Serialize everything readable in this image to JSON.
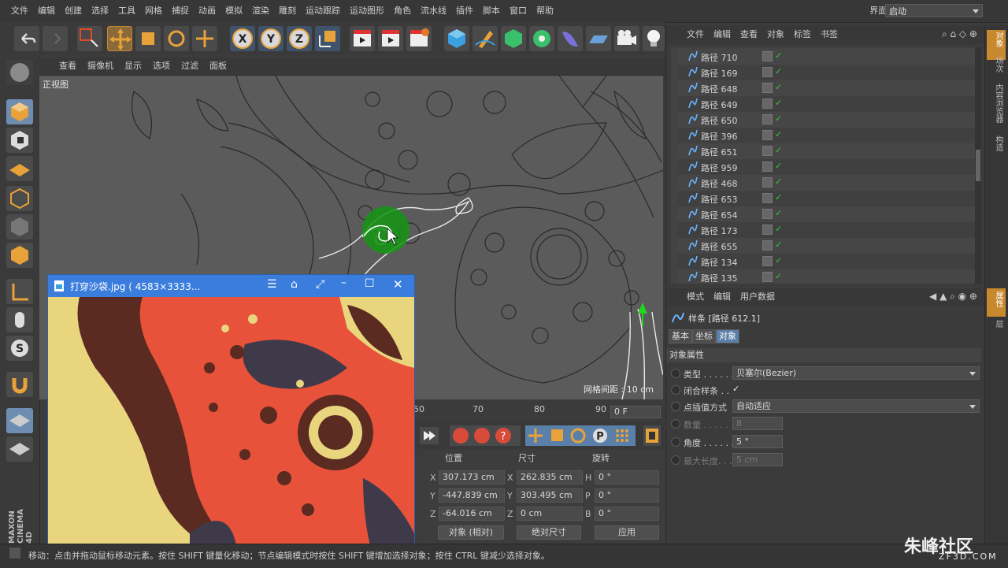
{
  "menubar": {
    "items": [
      "文件",
      "编辑",
      "创建",
      "选择",
      "工具",
      "网格",
      "捕捉",
      "动画",
      "模拟",
      "渲染",
      "雕刻",
      "运动跟踪",
      "运动图形",
      "角色",
      "流水线",
      "插件",
      "脚本",
      "窗口",
      "帮助"
    ],
    "layout_label": "界面:",
    "layout_value": "启动"
  },
  "viewport": {
    "menu": [
      "查看",
      "摄像机",
      "显示",
      "选项",
      "过滤",
      "面板"
    ],
    "title": "正视图",
    "grid_label": "网格间距 : 10 cm"
  },
  "timeline": {
    "ticks": [
      "50",
      "70",
      "80",
      "90"
    ],
    "frame": "0 F"
  },
  "coords": {
    "headers": [
      "位置",
      "尺寸",
      "旋转"
    ],
    "rows": [
      {
        "a1": "X",
        "v1": "307.173 cm",
        "a2": "X",
        "v2": "262.835 cm",
        "a3": "H",
        "v3": "0 °"
      },
      {
        "a1": "Y",
        "v1": "-447.839 cm",
        "a2": "Y",
        "v2": "303.495 cm",
        "a3": "P",
        "v3": "0 °"
      },
      {
        "a1": "Z",
        "v1": "-64.016 cm",
        "a2": "Z",
        "v2": "0 cm",
        "a3": "B",
        "v3": "0 °"
      }
    ],
    "mode_select": "对象 (相对)",
    "size_select": "绝对尺寸",
    "apply": "应用"
  },
  "status": {
    "text": "移动：点击并拖动鼠标移动元素。按住 SHIFT 键量化移动；节点编辑模式时按住 SHIFT 键增加选择对象；按住 CTRL 键减少选择对象。"
  },
  "brand": {
    "logo": "朱峰社区",
    "site": "ZF3D.COM",
    "side_logo": "MAXON CINEMA 4D"
  },
  "object_manager": {
    "menu": [
      "文件",
      "编辑",
      "查看",
      "对象",
      "标签",
      "书签"
    ],
    "objects": [
      "路径 710",
      "路径 169",
      "路径 648",
      "路径 649",
      "路径 650",
      "路径 396",
      "路径 651",
      "路径 959",
      "路径 468",
      "路径 653",
      "路径 654",
      "路径 173",
      "路径 655",
      "路径 134",
      "路径 135"
    ]
  },
  "attribute_manager": {
    "menu": [
      "模式",
      "编辑",
      "用户数据"
    ],
    "object_title": "样条 [路径 612.1]",
    "tabs": [
      "基本",
      "坐标",
      "对象"
    ],
    "section": "对象属性",
    "props": [
      {
        "label": "类型 . . . . . .",
        "value": "贝塞尔(Bezier)"
      },
      {
        "label": "闭合样条 . .",
        "value": "✓"
      },
      {
        "label": "点插值方式",
        "value": "自动适应"
      },
      {
        "label": "数量 . . . . . .",
        "value": "8"
      },
      {
        "label": "角度 . . . . . .",
        "value": "5 °"
      },
      {
        "label": "最大长度. . .",
        "value": "5 cm"
      }
    ]
  },
  "side_tabs": [
    "对象",
    "场次",
    "内容浏览器",
    "构造",
    "属性",
    "层"
  ],
  "image_window": {
    "title": "打穿沙袋.jpg ( 4583×3333..."
  },
  "colors": {
    "accent_blue": "#3b7ddd",
    "selection_orange": "#c8892e",
    "check_green": "#37c837"
  }
}
